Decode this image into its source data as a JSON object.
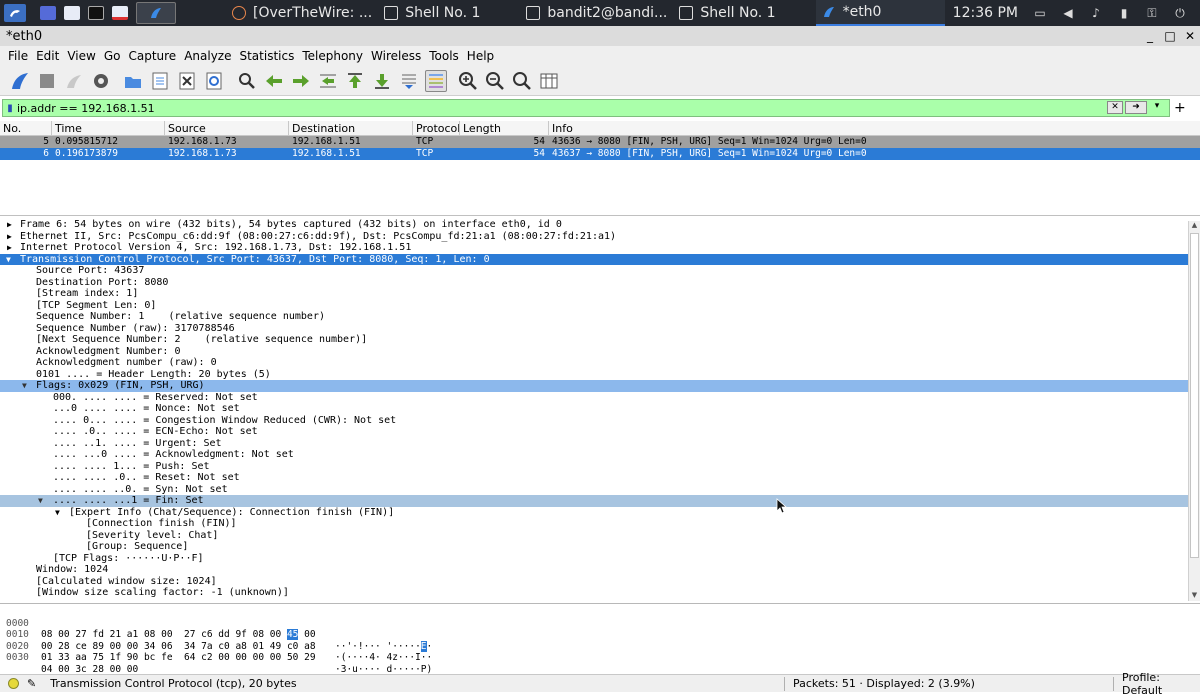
{
  "taskbar": {
    "tasks": [
      {
        "label": "[OverTheWire: ..."
      },
      {
        "label": "Shell No. 1"
      },
      {
        "label": "bandit2@bandi..."
      },
      {
        "label": "Shell No. 1"
      },
      {
        "label": "*eth0"
      }
    ],
    "clock": "12:36 PM"
  },
  "window": {
    "title": "*eth0"
  },
  "menu": [
    "File",
    "Edit",
    "View",
    "Go",
    "Capture",
    "Analyze",
    "Statistics",
    "Telephony",
    "Wireless",
    "Tools",
    "Help"
  ],
  "filter": {
    "value": "ip.addr == 192.168.1.51"
  },
  "packet_list": {
    "columns": [
      "No.",
      "Time",
      "Source",
      "Destination",
      "Protocol",
      "Length",
      "Info"
    ],
    "rows": [
      {
        "no": "5",
        "time": "0.095815712",
        "src": "192.168.1.73",
        "dst": "192.168.1.51",
        "proto": "TCP",
        "len": "54",
        "info": "43636 → 8080 [FIN, PSH, URG] Seq=1 Win=1024 Urg=0 Len=0"
      },
      {
        "no": "6",
        "time": "0.196173879",
        "src": "192.168.1.73",
        "dst": "192.168.1.51",
        "proto": "TCP",
        "len": "54",
        "info": "43637 → 8080 [FIN, PSH, URG] Seq=1 Win=1024 Urg=0 Len=0"
      }
    ]
  },
  "details": [
    "Frame 6: 54 bytes on wire (432 bits), 54 bytes captured (432 bits) on interface eth0, id 0",
    "Ethernet II, Src: PcsCompu_c6:dd:9f (08:00:27:c6:dd:9f), Dst: PcsCompu_fd:21:a1 (08:00:27:fd:21:a1)",
    "Internet Protocol Version 4, Src: 192.168.1.73, Dst: 192.168.1.51",
    "Transmission Control Protocol, Src Port: 43637, Dst Port: 8080, Seq: 1, Len: 0",
    "Source Port: 43637",
    "Destination Port: 8080",
    "[Stream index: 1]",
    "[TCP Segment Len: 0]",
    "Sequence Number: 1    (relative sequence number)",
    "Sequence Number (raw): 3170788546",
    "[Next Sequence Number: 2    (relative sequence number)]",
    "Acknowledgment Number: 0",
    "Acknowledgment number (raw): 0",
    "0101 .... = Header Length: 20 bytes (5)",
    "Flags: 0x029 (FIN, PSH, URG)",
    "000. .... .... = Reserved: Not set",
    "...0 .... .... = Nonce: Not set",
    ".... 0... .... = Congestion Window Reduced (CWR): Not set",
    ".... .0.. .... = ECN-Echo: Not set",
    ".... ..1. .... = Urgent: Set",
    ".... ...0 .... = Acknowledgment: Not set",
    ".... .... 1... = Push: Set",
    ".... .... .0.. = Reset: Not set",
    ".... .... ..0. = Syn: Not set",
    ".... .... ...1 = Fin: Set",
    "[Expert Info (Chat/Sequence): Connection finish (FIN)]",
    "[Connection finish (FIN)]",
    "[Severity level: Chat]",
    "[Group: Sequence]",
    "[TCP Flags: ······U·P··F]",
    "Window: 1024",
    "[Calculated window size: 1024]",
    "[Window size scaling factor: -1 (unknown)]"
  ],
  "bytes": [
    {
      "off": "0000",
      "hex_a": "08 00 27 fd 21 a1 08 00  27 c6 dd 9f 08 00 ",
      "hex_hl": "45",
      "hex_b": " 00",
      "asc_a": "··'·!··· '·····",
      "asc_hl": "E",
      "asc_b": "·"
    },
    {
      "off": "0010",
      "hex_a": "00 28 ce 89 00 00 34 06  34 7a c0 a8 01 49 c0 a8",
      "hex_hl": "",
      "hex_b": "",
      "asc_a": "·(····4· 4z···I··",
      "asc_hl": "",
      "asc_b": ""
    },
    {
      "off": "0020",
      "hex_a": "01 33 aa 75 1f 90 bc fe  64 c2 00 00 00 00 50 29",
      "hex_hl": "",
      "hex_b": "",
      "asc_a": "·3·u···· d·····P)",
      "asc_hl": "",
      "asc_b": ""
    },
    {
      "off": "0030",
      "hex_a": "04 00 3c 28 00 00",
      "hex_hl": "",
      "hex_b": "",
      "asc_a": "··<(··",
      "asc_hl": "",
      "asc_b": ""
    }
  ],
  "status": {
    "selected": "Transmission Control Protocol (tcp), 20 bytes",
    "packets": "Packets: 51 · Displayed: 2 (3.9%)",
    "profile": "Profile: Default"
  }
}
